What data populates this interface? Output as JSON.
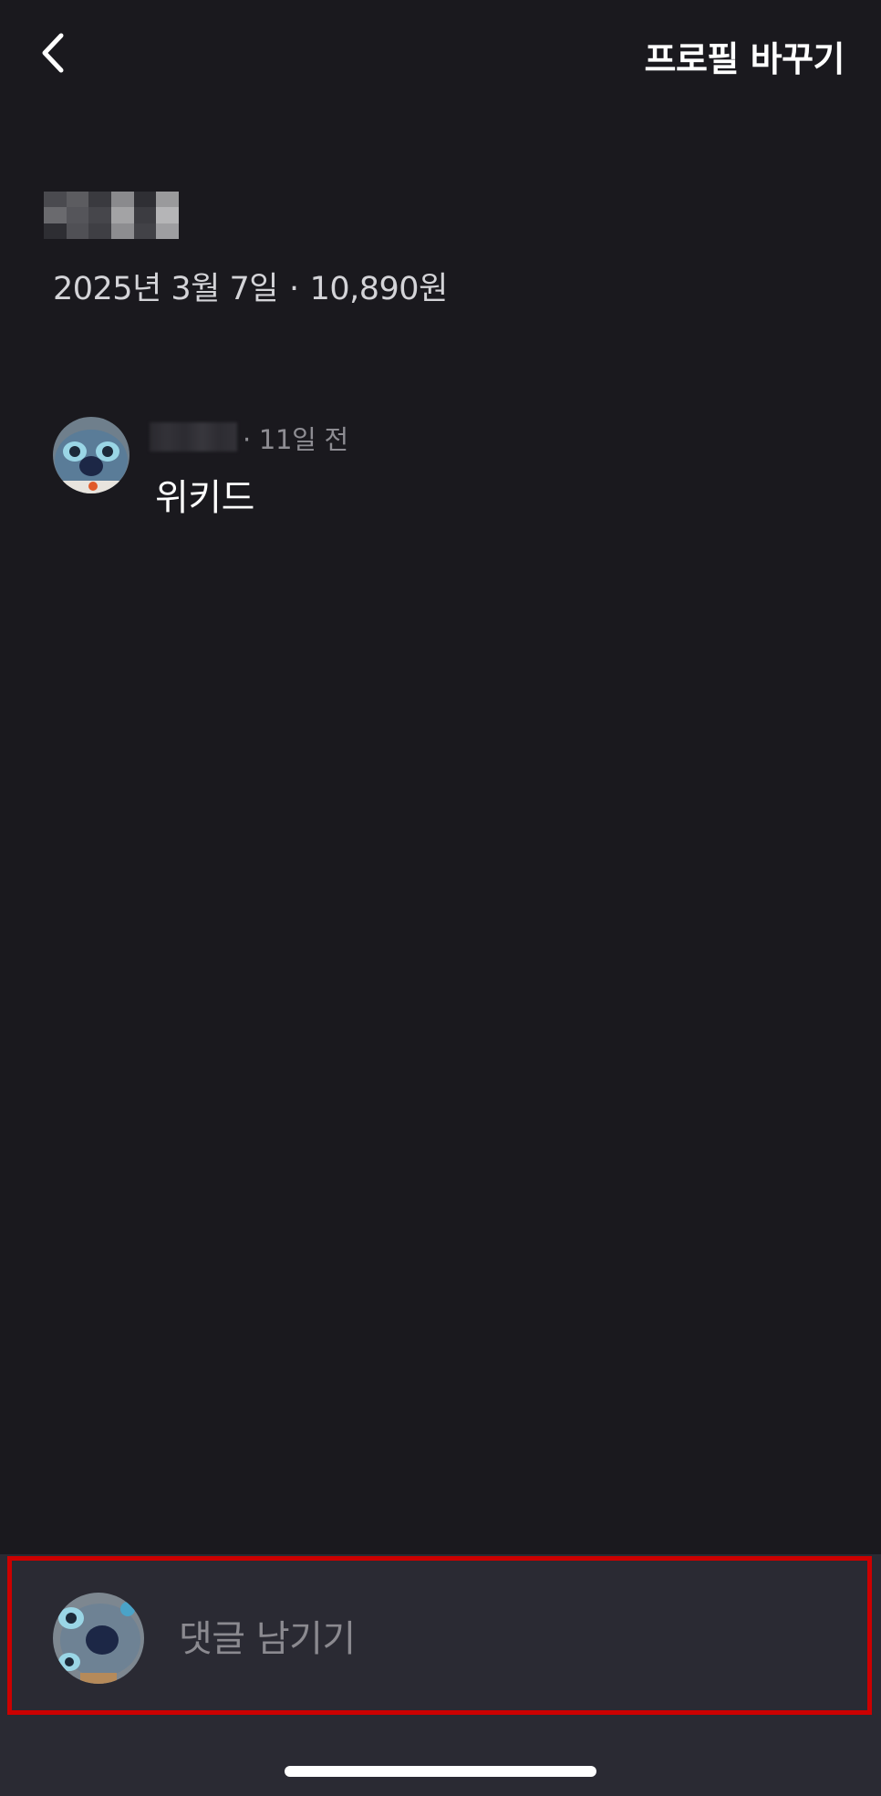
{
  "header": {
    "back_icon": "chevron-left-icon",
    "action_label": "프로필 바꾸기"
  },
  "record": {
    "date": "2025년 3월 7일",
    "separator": "·",
    "price": "10,890원"
  },
  "comments": [
    {
      "separator": "·",
      "time": "11일 전",
      "text": "위키드"
    }
  ],
  "comment_input": {
    "placeholder": "댓글 남기기"
  },
  "colors": {
    "background": "#1a191e",
    "input_bar": "#2a2a33",
    "highlight": "#cc0000",
    "muted_text": "#8e8d93"
  }
}
